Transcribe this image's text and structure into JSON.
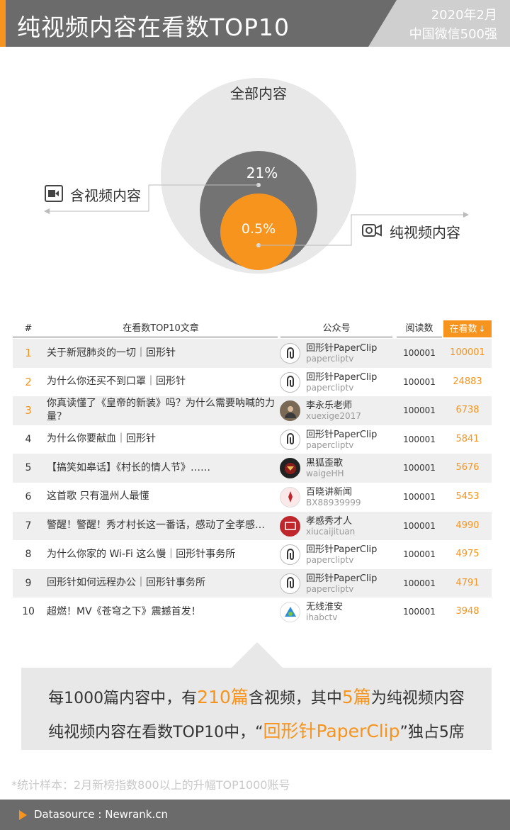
{
  "header": {
    "title": "纯视频内容在看数TOP10",
    "date": "2020年2月",
    "scope": "中国微信500强"
  },
  "venn": {
    "all_label": "全部内容",
    "video_pct": "21%",
    "pure_pct": "0.5%",
    "video_legend": "含视频内容",
    "pure_legend": "纯视频内容",
    "colors": {
      "all": "#e8e8e8",
      "video": "#737373",
      "pure": "#f7941d"
    }
  },
  "table": {
    "headers": {
      "num": "#",
      "title": "在看数TOP10文章",
      "account": "公众号",
      "reads": "阅读数",
      "watch": "在看数"
    },
    "rows": [
      {
        "rank": "1",
        "title": "关于新冠肺炎的一切｜回形针",
        "account": "回形针PaperClip",
        "account_id": "papercliptv",
        "reads": "100001",
        "watch": "100001",
        "avatar": "paperclip"
      },
      {
        "rank": "2",
        "title": "为什么你还买不到口罩｜回形针",
        "account": "回形针PaperClip",
        "account_id": "papercliptv",
        "reads": "100001",
        "watch": "24883",
        "avatar": "paperclip"
      },
      {
        "rank": "3",
        "title": "你真读懂了《皇帝的新装》吗？为什么需要呐喊的力量？",
        "account": "李永乐老师",
        "account_id": "xuexige2017",
        "reads": "100001",
        "watch": "6738",
        "avatar": "person"
      },
      {
        "rank": "4",
        "title": "为什么你要献血｜回形针",
        "account": "回形针PaperClip",
        "account_id": "papercliptv",
        "reads": "100001",
        "watch": "5841",
        "avatar": "paperclip"
      },
      {
        "rank": "5",
        "title": "【搞笑如皋话】《村长的情人节》……",
        "account": "黑狐歪歌",
        "account_id": "waigeHH",
        "reads": "100001",
        "watch": "5676",
        "avatar": "fox"
      },
      {
        "rank": "6",
        "title": "这首歌 只有温州人最懂",
        "account": "百晓讲新闻",
        "account_id": "BX88939999",
        "reads": "100001",
        "watch": "5453",
        "avatar": "news"
      },
      {
        "rank": "7",
        "title": "警醒！警醒！秀才村长这一番话，感动了全孝感…",
        "account": "孝感秀才人",
        "account_id": "xiucaijituan",
        "reads": "100001",
        "watch": "4990",
        "avatar": "xiaogan"
      },
      {
        "rank": "8",
        "title": "为什么你家的 Wi-Fi 这么慢｜回形针事务所",
        "account": "回形针PaperClip",
        "account_id": "papercliptv",
        "reads": "100001",
        "watch": "4975",
        "avatar": "paperclip"
      },
      {
        "rank": "9",
        "title": "回形针如何远程办公｜回形针事务所",
        "account": "回形针PaperClip",
        "account_id": "papercliptv",
        "reads": "100001",
        "watch": "4791",
        "avatar": "paperclip"
      },
      {
        "rank": "10",
        "title": "超燃！MV《苍穹之下》震撼首发！",
        "account": "无线淮安",
        "account_id": "ihabctv",
        "reads": "100001",
        "watch": "3948",
        "avatar": "huaian"
      }
    ]
  },
  "callout": {
    "l1_a": "每1000篇内容中，有",
    "l1_b": "210篇",
    "l1_c": "含视频，其中",
    "l1_d": "5篇",
    "l1_e": "为纯视频内容",
    "l2_a": "纯视频内容在看数TOP10中，“",
    "l2_b": "回形针PaperClip",
    "l2_c": "”独占5席"
  },
  "note": "*统计样本：2月新榜指数800以上的升幅TOP1000账号",
  "footer": {
    "source": "Datasource : Newrank.cn"
  },
  "accent_color": "#f7941d"
}
